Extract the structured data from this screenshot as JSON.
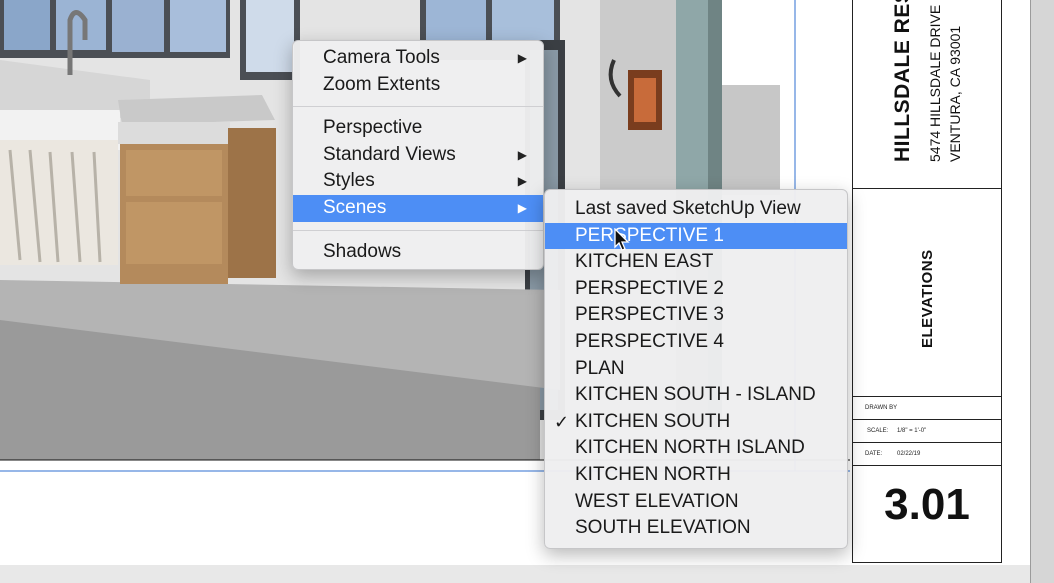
{
  "context_menu": {
    "items": [
      {
        "label": "Camera Tools",
        "submenu": true
      },
      {
        "label": "Zoom Extents",
        "submenu": false
      },
      {
        "label": "Perspective",
        "submenu": false
      },
      {
        "label": "Standard Views",
        "submenu": true
      },
      {
        "label": "Styles",
        "submenu": true
      },
      {
        "label": "Scenes",
        "submenu": true,
        "active": true
      },
      {
        "label": "Shadows",
        "submenu": false
      }
    ],
    "arrow_glyph": "▶"
  },
  "scenes_menu": {
    "items": [
      "Last saved SketchUp View",
      "PERSPECTIVE 1",
      "KITCHEN EAST",
      "PERSPECTIVE 2",
      "PERSPECTIVE 3",
      "PERSPECTIVE 4",
      "PLAN",
      "KITCHEN SOUTH - ISLAND",
      "KITCHEN SOUTH",
      "KITCHEN NORTH ISLAND",
      "KITCHEN NORTH",
      "WEST ELEVATION",
      "SOUTH ELEVATION"
    ],
    "highlighted": "PERSPECTIVE 1",
    "checked": "KITCHEN SOUTH",
    "check_glyph": "✓"
  },
  "title_block": {
    "project": "HILLSDALE RES",
    "address_line1": "5474 HILLSDALE DRIVE",
    "address_line2": "VENTURA, CA 93001",
    "sheet_title": "ELEVATIONS",
    "drawn_by_label": "DRAWN BY",
    "scale_label": "SCALE:",
    "scale_value": "1/8\" = 1'-0\"",
    "date_label": "DATE:",
    "date_value": "02/22/19",
    "sheet_number": "3.01"
  },
  "colors": {
    "menu_highlight": "#4d8ef5",
    "cabinet_wood": "#b48a5c",
    "counter": "#cfcfcf",
    "floor": "#9a9a9a"
  }
}
